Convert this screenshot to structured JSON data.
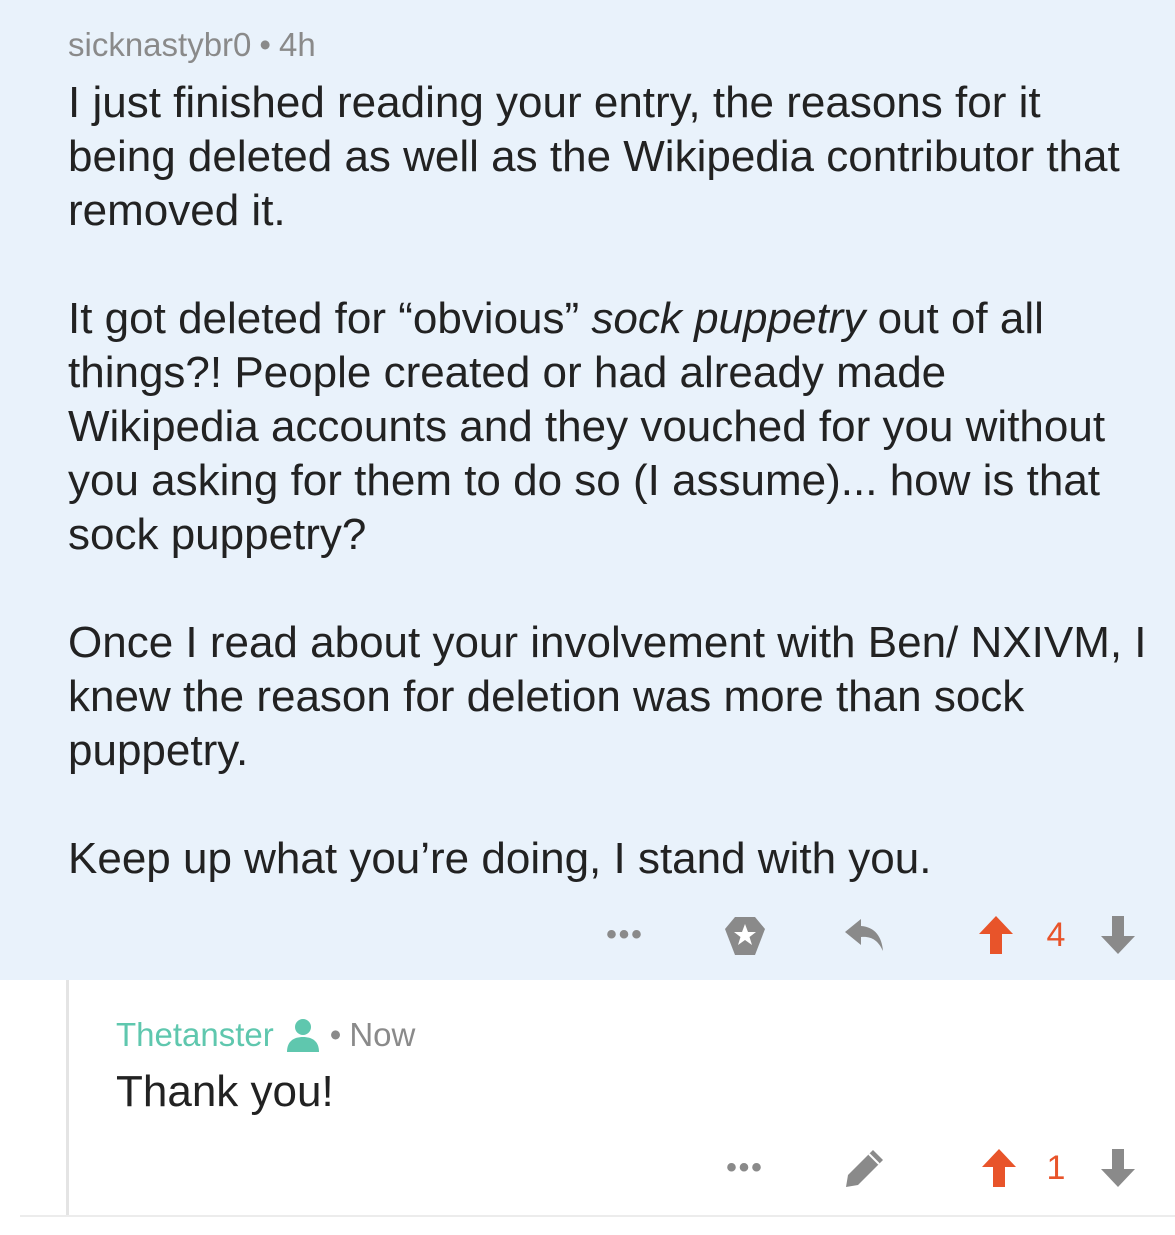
{
  "comment1": {
    "author": "sicknastybr0",
    "separator": "•",
    "age": "4h",
    "paragraphs": {
      "p1": "I just finished reading your entry, the reasons for it being deleted as well as the Wikipedia contributor that removed it.",
      "p2_before": "It got deleted for “obvious” ",
      "p2_em": "sock puppetry",
      "p2_after": " out of all things?! People created or had already made Wikipedia accounts and they vouched for you without you asking for them to do so (I assume)... how is that sock puppetry?",
      "p3": "Once I read about your involvement with Ben/ NXIVM, I knew the reason for deletion was more than sock puppetry.",
      "p4": "Keep up what you’re doing, I stand with you."
    },
    "actions": {
      "more": "•••",
      "award_icon": "award-star-icon",
      "reply_icon": "reply-arrow-icon",
      "upvote_icon": "upvote-arrow-icon",
      "vote_count": "4",
      "downvote_icon": "downvote-arrow-icon"
    }
  },
  "comment2": {
    "author": "Thetanster",
    "author_icon": "op-user-icon",
    "separator": "•",
    "age": "Now",
    "text": "Thank you!",
    "actions": {
      "more": "•••",
      "edit_icon": "pencil-edit-icon",
      "upvote_icon": "upvote-arrow-icon",
      "vote_count": "1",
      "downvote_icon": "downvote-arrow-icon"
    }
  },
  "colors": {
    "highlight_bg": "#e9f2fb",
    "upvoted": "#e8542a",
    "op_author": "#5fc7ae",
    "muted": "#8a8a8a"
  }
}
